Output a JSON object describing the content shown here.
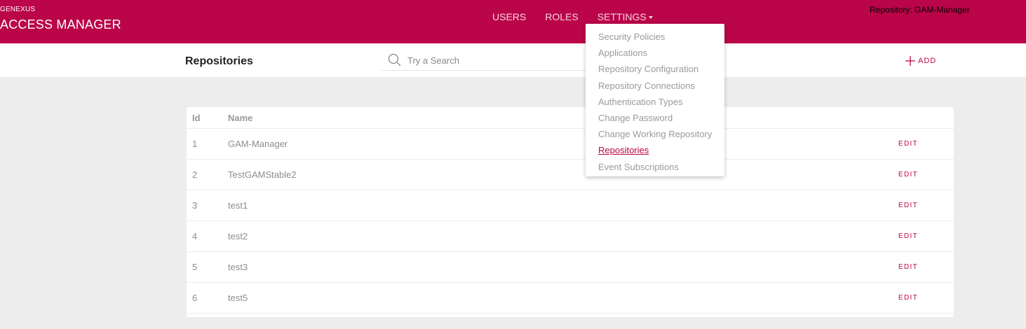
{
  "header": {
    "brand_small": "GENEXUS",
    "brand_title": "ACCESS MANAGER",
    "nav": [
      "USERS",
      "ROLES",
      "SETTINGS"
    ],
    "repository_indicator": "Repository: GAM-Manager",
    "accent_color": "#ba0548"
  },
  "subheader": {
    "page_title": "Repositories",
    "search_placeholder": "Try a Search",
    "add_label": "ADD"
  },
  "settings_menu": {
    "items": [
      "Security Policies",
      "Applications",
      "Repository Configuration",
      "Repository Connections",
      "Authentication Types",
      "Change Password",
      "Change Working Repository",
      "Repositories",
      "Event Subscriptions"
    ],
    "active_item": "Repositories"
  },
  "table": {
    "columns": [
      "Id",
      "Name"
    ],
    "rows": [
      {
        "id": "1",
        "name": "GAM-Manager",
        "action": "EDIT"
      },
      {
        "id": "2",
        "name": "TestGAMStable2",
        "action": "EDIT"
      },
      {
        "id": "3",
        "name": "test1",
        "action": "EDIT"
      },
      {
        "id": "4",
        "name": "test2",
        "action": "EDIT"
      },
      {
        "id": "5",
        "name": "test3",
        "action": "EDIT"
      },
      {
        "id": "6",
        "name": "test5",
        "action": "EDIT"
      }
    ]
  },
  "icons": {
    "search": "search-icon",
    "add": "plus-icon",
    "settings_caret": "chevron-down-icon"
  }
}
